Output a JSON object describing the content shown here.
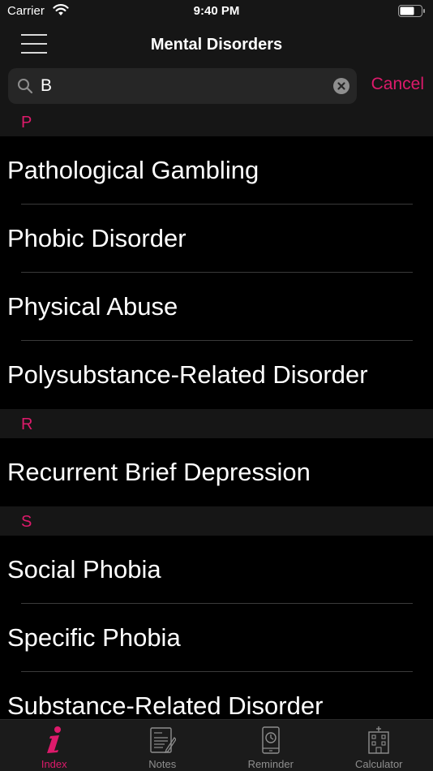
{
  "status_bar": {
    "carrier": "Carrier",
    "time": "9:40 PM"
  },
  "nav": {
    "title": "Mental Disorders"
  },
  "search": {
    "value": "B",
    "cancel_label": "Cancel"
  },
  "sections": [
    {
      "header": "P",
      "items": [
        "Pathological Gambling",
        "Phobic Disorder",
        "Physical Abuse",
        "Polysubstance-Related Disorder"
      ]
    },
    {
      "header": "R",
      "items": [
        "Recurrent Brief Depression"
      ]
    },
    {
      "header": "S",
      "items": [
        "Social Phobia",
        "Specific Phobia",
        "Substance-Related Disorder"
      ]
    }
  ],
  "tabs": [
    {
      "label": "Index",
      "icon": "info-icon",
      "active": true
    },
    {
      "label": "Notes",
      "icon": "notes-icon",
      "active": false
    },
    {
      "label": "Reminder",
      "icon": "reminder-icon",
      "active": false
    },
    {
      "label": "Calculator",
      "icon": "calculator-icon",
      "active": false
    }
  ],
  "colors": {
    "accent": "#dd1a6b",
    "background": "#000000",
    "bar": "#161616"
  }
}
